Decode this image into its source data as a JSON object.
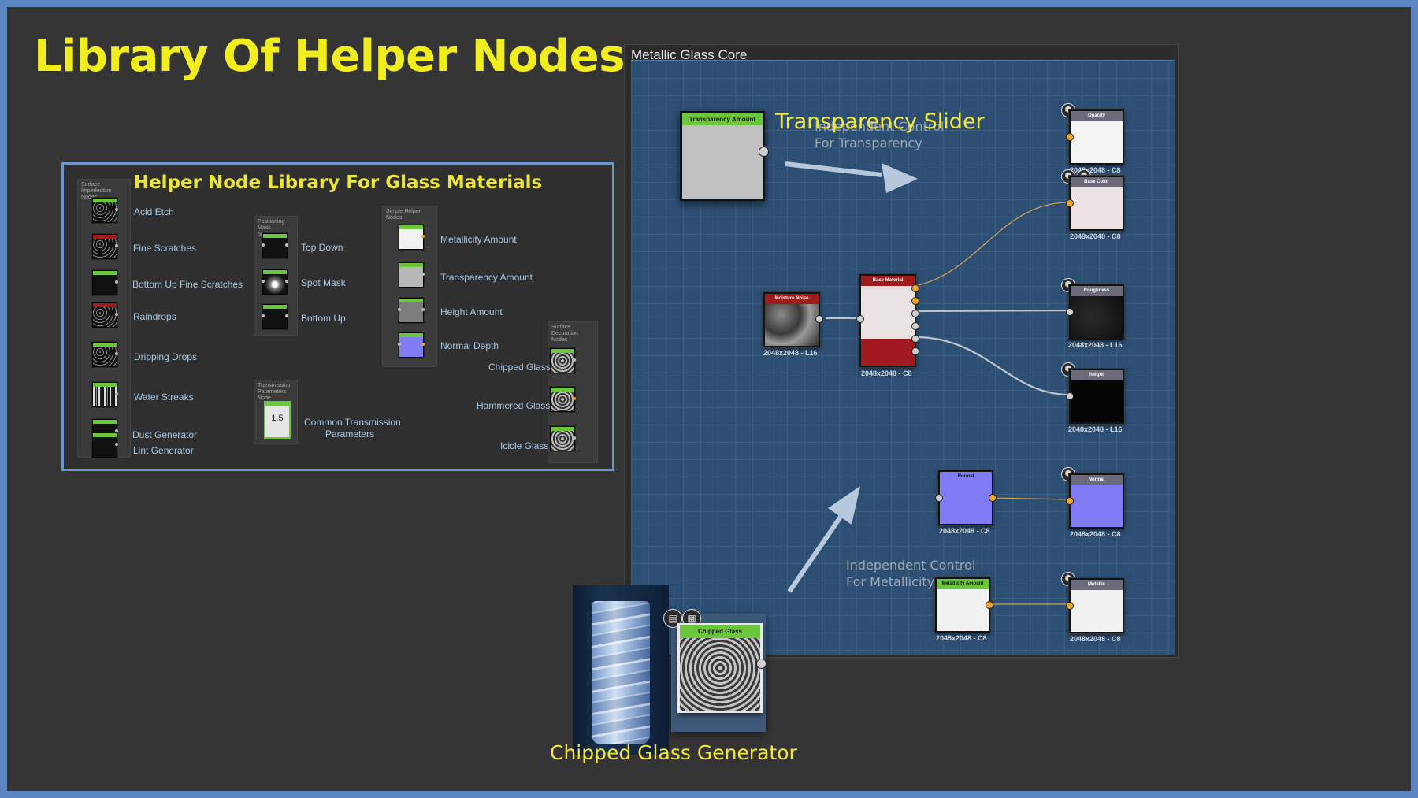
{
  "page": {
    "title": "Library Of Helper Nodes",
    "captions": {
      "transparency_slider": "Transparency Slider",
      "chipped_glass_generator": "Chipped Glass Generator",
      "note_transparency": [
        "Independent Control",
        "For Transparency"
      ],
      "note_metallicity": [
        "Independent Control",
        "For Metallicity"
      ]
    }
  },
  "library": {
    "title": "Helper Node Library For Glass Materials",
    "surface_imperfection": {
      "frame_title": [
        "Surface Imperfection",
        "Nodes"
      ],
      "items": [
        "Acid Etch",
        "Fine Scratches",
        "Bottom Up Fine Scratches",
        "Raindrops",
        "Dripping Drops",
        "Water Streaks",
        "Dust Generator",
        "Lint Generator"
      ]
    },
    "positioning_mask": {
      "frame_title": [
        "Positioning Mask",
        "Nodes"
      ],
      "items": [
        "Top Down",
        "Spot Mask",
        "Bottom Up"
      ]
    },
    "transmission": {
      "frame_title": [
        "Transmission",
        "Parameters Node"
      ],
      "value": "1.5",
      "label": [
        "Common Transmission",
        "Parameters"
      ]
    },
    "simple_helper": {
      "frame_title": "Simple Helper Nodes",
      "items": [
        "Metallicity Amount",
        "Transparency Amount",
        "Height Amount",
        "Normal Depth"
      ]
    },
    "surface_decoration": {
      "frame_title": [
        "Surface Decoration",
        "Nodes"
      ],
      "items": [
        "Chipped Glass",
        "Hammered Glass",
        "Icicle Glass"
      ]
    }
  },
  "floating_nodes": {
    "transparency_amount": "Transparency Amount",
    "chipped_glass": "Chipped Glass"
  },
  "graph": {
    "window_title": "Metallic Glass Core",
    "nodes": {
      "moisture_noise": {
        "title": "Moisture Noise",
        "res": "2048x2048 - L16"
      },
      "base_material": {
        "title": "Base Material",
        "res": "2048x2048 - C8"
      },
      "opacity": {
        "title": "Opacity",
        "res": "2048x2048 - C8",
        "tag": "opacity"
      },
      "base_color": {
        "title": "Base Color",
        "res": "2048x2048 - C8"
      },
      "roughness": {
        "title": "Roughness",
        "res": "2048x2048 - L16",
        "tag": "roughness"
      },
      "height": {
        "title": "height",
        "res": "2048x2048 - L16",
        "tag": "height"
      },
      "normal_in": {
        "title": "Normal",
        "res": "2048x2048 - C8"
      },
      "normal_out": {
        "title": "Normal",
        "res": "2048x2048 - C8",
        "tag": "normal"
      },
      "metallicity_amount": {
        "title": "Metallicity Amount",
        "res": "2048x2048 - C8"
      },
      "metallic": {
        "title": "Metallic",
        "res": "2048x2048 - C8",
        "tag": "metallic"
      }
    }
  },
  "colors": {
    "title_yellow": "#f2ee1e",
    "frame_border": "#6c96cf",
    "graph_bg": "#2e4f74",
    "node_header_green": "#6cc63c",
    "node_header_red": "#a01c1c",
    "node_header_gray": "#6a6a7a",
    "normal_purple": "#7f7cf6",
    "port_orange": "#f0a32c"
  }
}
